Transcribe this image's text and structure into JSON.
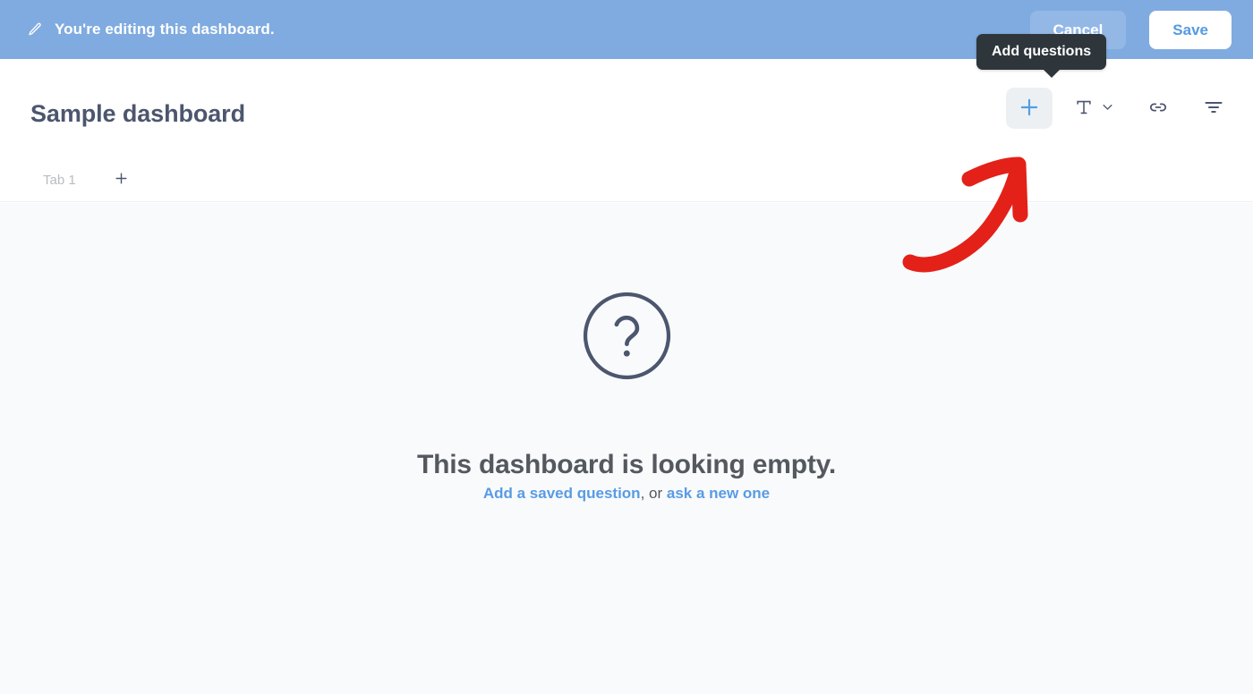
{
  "edit_banner": {
    "icon": "pencil-icon",
    "message": "You're editing this dashboard.",
    "cancel_label": "Cancel",
    "save_label": "Save",
    "background_color": "#7FABE0",
    "save_text_color": "#549BE0"
  },
  "tooltip": {
    "text": "Add questions",
    "background_color": "#2E353B"
  },
  "header": {
    "title": "Sample dashboard",
    "title_color": "#4C566E"
  },
  "toolbar": {
    "items": [
      {
        "name": "add-questions-button",
        "icon": "plus-icon",
        "active": true,
        "accent_color": "#509EE3"
      },
      {
        "name": "add-text-button",
        "icon": "text-t-icon",
        "active": false
      },
      {
        "name": "add-link-button",
        "icon": "link-icon",
        "active": false
      },
      {
        "name": "add-filter-button",
        "icon": "filter-icon",
        "active": false
      }
    ]
  },
  "tabs": {
    "items": [
      {
        "label": "Tab 1",
        "active": false
      }
    ],
    "add_tab_icon": "plus-icon"
  },
  "empty_state": {
    "icon": "question-mark-circle-icon",
    "title": "This dashboard is looking empty.",
    "link_saved": "Add a saved question",
    "separator": ", or ",
    "link_new": "ask a new one",
    "link_color": "#589BE5"
  },
  "annotation": {
    "type": "hand-drawn-arrow",
    "direction": "up-right",
    "color": "#E32119",
    "points_to": "add-questions-button"
  },
  "colors": {
    "page_background": "#F9FAFB",
    "header_background": "#ffffff",
    "border": "#EDF0F2"
  }
}
